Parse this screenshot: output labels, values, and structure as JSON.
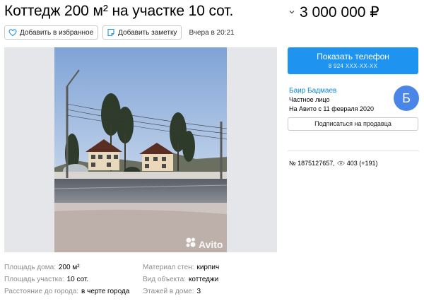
{
  "listing": {
    "title": "Коттедж 200 м² на участке 10 сот.",
    "price": "3 000 000 ₽"
  },
  "actions": {
    "favorite_label": "Добавить в избранное",
    "note_label": "Добавить заметку",
    "date": "Вчера в 20:21"
  },
  "gallery": {
    "watermark": "Avito"
  },
  "params": {
    "col1": [
      {
        "key": "Площадь дома:",
        "value": "200 м²"
      },
      {
        "key": "Площадь участка:",
        "value": "10 сот."
      },
      {
        "key": "Расстояние до города:",
        "value": "в черте города"
      }
    ],
    "col2": [
      {
        "key": "Материал стен:",
        "value": "кирпич"
      },
      {
        "key": "Вид объекта:",
        "value": "коттеджи"
      },
      {
        "key": "Этажей в доме:",
        "value": "3"
      }
    ]
  },
  "contact": {
    "show_phone_label": "Показать телефон",
    "phone_masked": "8 924 XXX-XX-XX",
    "subscribe_label": "Подписаться на продавца"
  },
  "seller": {
    "name": "Баир Бадмаев",
    "type": "Частное лицо",
    "since": "На Авито с 11 февраля 2020",
    "avatar_letter": "Б",
    "avatar_color": "#4a86e8"
  },
  "meta": {
    "ad_number": "№ 1875127657,",
    "views": "403 (+191)"
  },
  "colors": {
    "accent": "#1e94f0",
    "link": "#0a88d4"
  }
}
